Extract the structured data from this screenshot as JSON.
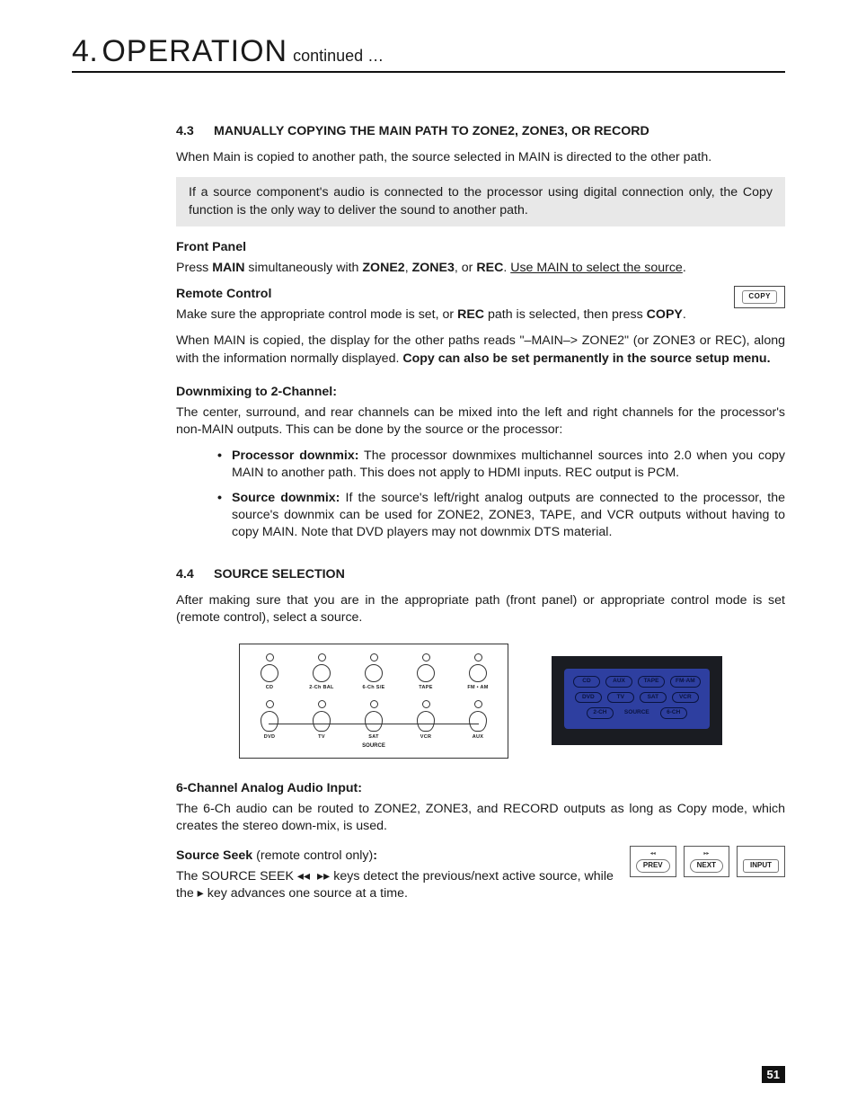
{
  "header": {
    "number": "4.",
    "title": "OPERATION",
    "continued": "continued …"
  },
  "section43": {
    "num": "4.3",
    "title": "MANUALLY COPYING THE MAIN PATH TO ZONE2, ZONE3, OR RECORD",
    "intro": "When Main is copied to another path, the source selected in MAIN is directed to the other path.",
    "note": "If a source component's audio is connected to the processor using digital connection only, the Copy function is the only way to deliver the sound to another path.",
    "front_panel_head": "Front Panel",
    "fp_press": "Press ",
    "fp_main": "MAIN",
    "fp_mid1": " simultaneously with ",
    "fp_zone2": "ZONE2",
    "fp_comma1": ", ",
    "fp_zone3": "ZONE3",
    "fp_comma2": ", or ",
    "fp_rec": "REC",
    "fp_period": ". ",
    "fp_under": "Use MAIN to select the source",
    "fp_end": ".",
    "remote_head": "Remote Control",
    "remote_make": "Make sure the appropriate control mode is set, or ",
    "remote_rec": "REC",
    "remote_mid": " path is selected, then press ",
    "remote_copy": "COPY",
    "remote_end": ".",
    "copy_btn_label": "COPY",
    "when_copied_a": "When MAIN is copied, the display for the other paths reads \"–MAIN–> ZONE2\" (or ZONE3 or REC), along with the information normally displayed. ",
    "when_copied_b": "Copy can also be set permanently in the source setup menu.",
    "downmix_head": "Downmixing to 2-Channel:",
    "downmix_body": "The center, surround, and rear channels can be mixed into the left and right channels for the processor's non-MAIN outputs. This can be done by the source or the processor:",
    "bullet1_lead": "Processor downmix:",
    "bullet1_rest": " The processor downmixes multichannel sources into 2.0 when you copy MAIN to another path. This does not apply to HDMI inputs. REC output is PCM.",
    "bullet2_lead": "Source downmix:",
    "bullet2_rest": "  If the source's left/right analog outputs are connected to the processor, the source's downmix can be used for ZONE2, ZONE3, TAPE, and VCR outputs without having to copy MAIN. Note that DVD players may not downmix DTS material."
  },
  "section44": {
    "num": "4.4",
    "title": "SOURCE SELECTION",
    "intro": "After making sure that you are in the appropriate path (front panel) or appropriate control mode is set (remote control), select a source.",
    "front_row1": [
      "CD",
      "2-Ch BAL",
      "6-Ch S/E",
      "TAPE",
      "FM • AM"
    ],
    "front_row2": [
      "DVD",
      "TV",
      "SAT",
      "VCR",
      "AUX"
    ],
    "front_source_label": "SOURCE",
    "remote_row1": [
      "CD",
      "AUX",
      "TAPE",
      "FM·AM"
    ],
    "remote_row2": [
      "DVD",
      "TV",
      "SAT",
      "VCR"
    ],
    "remote_row3_left": "2-CH",
    "remote_row3_right": "6-CH",
    "remote_source_label": "SOURCE",
    "six_ch_head": "6-Channel Analog Audio Input:",
    "six_ch_body": "The 6-Ch audio can be routed to ZONE2, ZONE3, and RECORD outputs as long as Copy mode, which creates the stereo down-mix, is used.",
    "seek_head": "Source Seek",
    "seek_head_tail": " (remote control only)",
    "seek_colon": ":",
    "seek_body_a": "The SOURCE SEEK ",
    "seek_body_b": " keys detect the previous/next active source, while the ",
    "seek_body_c": " key advances one source at a time.",
    "seek_prev_top": "◂◂",
    "seek_next_top": "▸▸",
    "seek_prev": "PREV",
    "seek_next": "NEXT",
    "seek_input": "INPUT"
  },
  "page_number": "51"
}
